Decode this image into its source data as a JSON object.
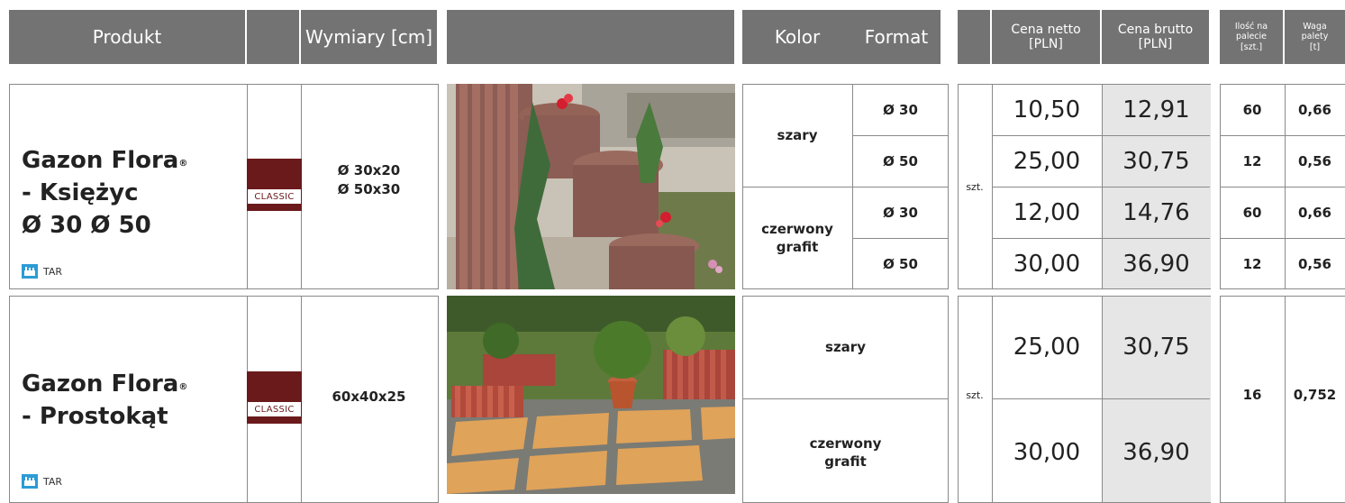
{
  "header": {
    "produkt": "Produkt",
    "wymiary": "Wymiary [cm]",
    "kolor": "Kolor",
    "format": "Format",
    "cena_netto_1": "Cena netto",
    "cena_netto_2": "[PLN]",
    "cena_brutto_1": "Cena brutto",
    "cena_brutto_2": "[PLN]",
    "ilosc_1": "Ilość na",
    "ilosc_2": "palecie",
    "ilosc_3": "[szt.]",
    "waga_1": "Waga",
    "waga_2": "palety",
    "waga_3": "[t]"
  },
  "products": [
    {
      "name_line1": "Gazon Flora",
      "reg": "®",
      "name_line2": "- Księżyc",
      "name_line3": "Ø 30 Ø 50",
      "badge": "CLASSIC",
      "plant": "TAR",
      "dims_1": "Ø 30x20",
      "dims_2": "Ø 50x30",
      "colors": [
        {
          "label_1": "szary",
          "label_2": ""
        },
        {
          "label_1": "czerwony",
          "label_2": "grafit"
        }
      ],
      "unit": "szt.",
      "rows": [
        {
          "format": "Ø 30",
          "netto": "10,50",
          "brutto": "12,91",
          "ilosc": "60",
          "waga": "0,66"
        },
        {
          "format": "Ø 50",
          "netto": "25,00",
          "brutto": "30,75",
          "ilosc": "12",
          "waga": "0,56"
        },
        {
          "format": "Ø 30",
          "netto": "12,00",
          "brutto": "14,76",
          "ilosc": "60",
          "waga": "0,66"
        },
        {
          "format": "Ø 50",
          "netto": "30,00",
          "brutto": "36,90",
          "ilosc": "12",
          "waga": "0,56"
        }
      ]
    },
    {
      "name_line1": "Gazon Flora",
      "reg": "®",
      "name_line2": "- Prostokąt",
      "badge": "CLASSIC",
      "plant": "TAR",
      "dims_1": "60x40x25",
      "colors": [
        {
          "label_1": "szary",
          "label_2": ""
        },
        {
          "label_1": "czerwony",
          "label_2": "grafit"
        }
      ],
      "unit": "szt.",
      "rows": [
        {
          "netto": "25,00",
          "brutto": "30,75"
        },
        {
          "netto": "30,00",
          "brutto": "36,90"
        }
      ],
      "ilosc": "16",
      "waga": "0,752"
    }
  ]
}
